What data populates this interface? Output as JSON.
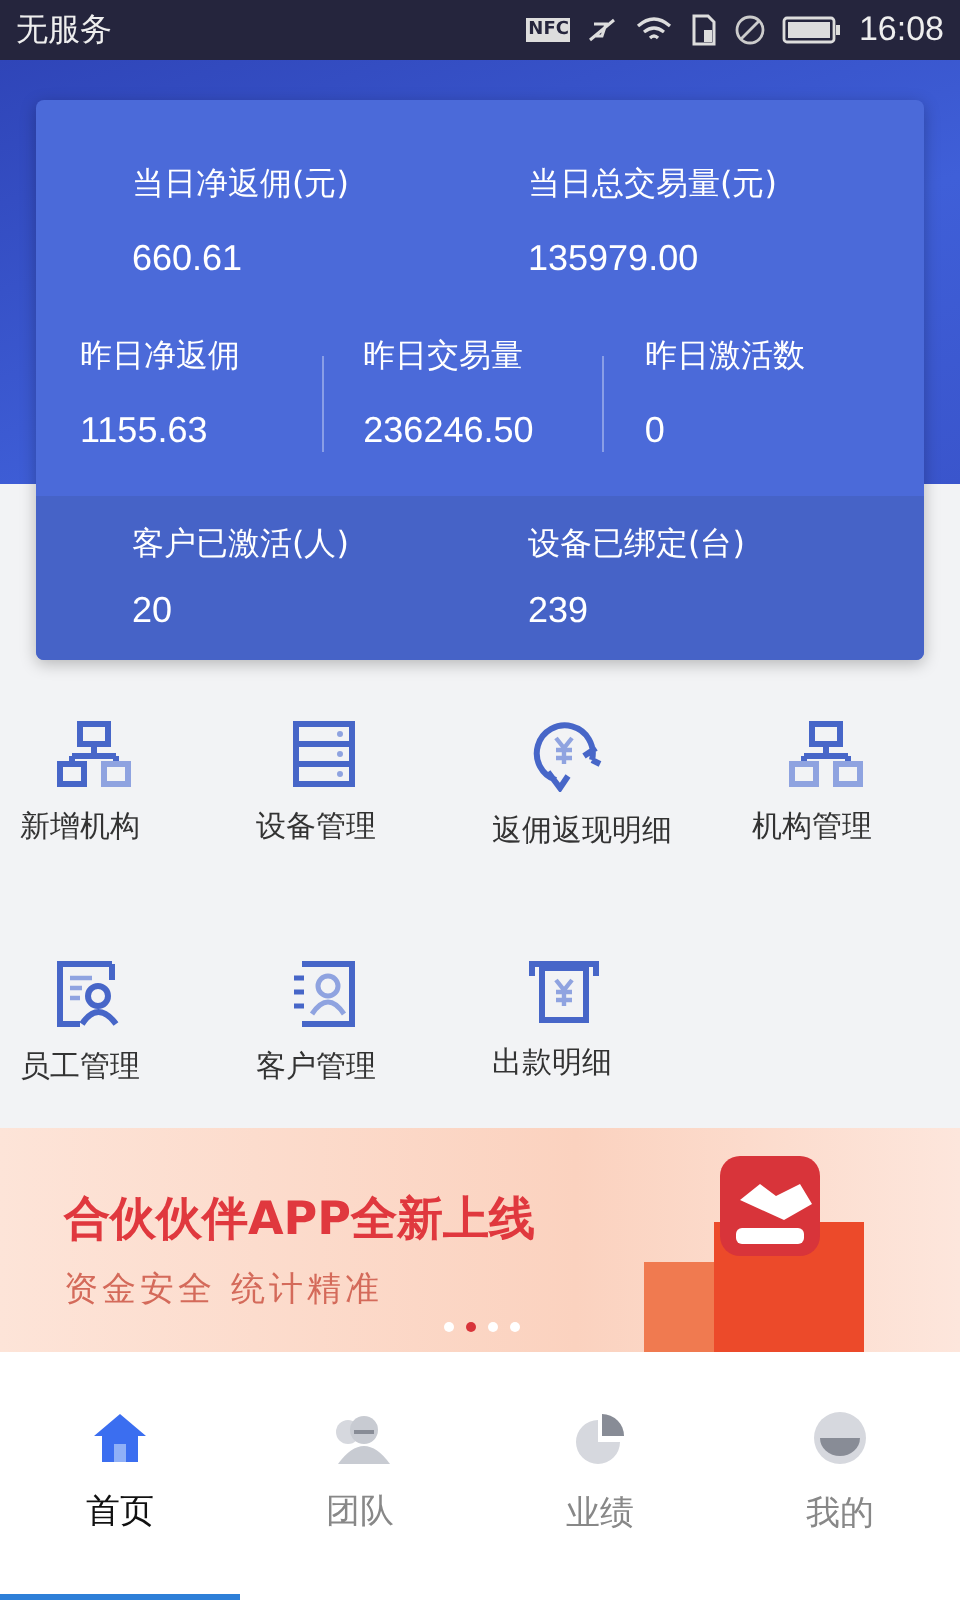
{
  "status_bar": {
    "carrier": "无服务",
    "nfc": "NFC",
    "time": "16:08"
  },
  "summary": {
    "top": [
      {
        "label": "当日净返佣(元)",
        "value": "660.61"
      },
      {
        "label": "当日总交易量(元)",
        "value": "135979.00"
      }
    ],
    "middle": [
      {
        "label": "昨日净返佣",
        "value": "1155.63"
      },
      {
        "label": "昨日交易量",
        "value": "236246.50"
      },
      {
        "label": "昨日激活数",
        "value": "0"
      }
    ],
    "bottom": [
      {
        "label": "客户已激活(人)",
        "value": "20"
      },
      {
        "label": "设备已绑定(台)",
        "value": "239"
      }
    ]
  },
  "menu": [
    {
      "label": "新增机构",
      "kind": "org"
    },
    {
      "label": "设备管理",
      "kind": "server"
    },
    {
      "label": "返佣返现明细",
      "kind": "yen-arrow"
    },
    {
      "label": "机构管理",
      "kind": "org-light"
    },
    {
      "label": "员工管理",
      "kind": "staff"
    },
    {
      "label": "客户管理",
      "kind": "contacts"
    },
    {
      "label": "出款明细",
      "kind": "yen-slip"
    }
  ],
  "banner": {
    "title": "合伙伙伴APP全新上线",
    "subtitle": "资金安全  统计精准",
    "dots": [
      {
        "selected": false
      },
      {
        "selected": true
      },
      {
        "selected": false
      },
      {
        "selected": false
      }
    ]
  },
  "tab_bar": [
    {
      "label": "首页",
      "kind": "home",
      "selected": true
    },
    {
      "label": "团队",
      "kind": "team",
      "selected": false
    },
    {
      "label": "业绩",
      "kind": "chart",
      "selected": false
    },
    {
      "label": "我的",
      "kind": "me",
      "selected": false
    }
  ]
}
